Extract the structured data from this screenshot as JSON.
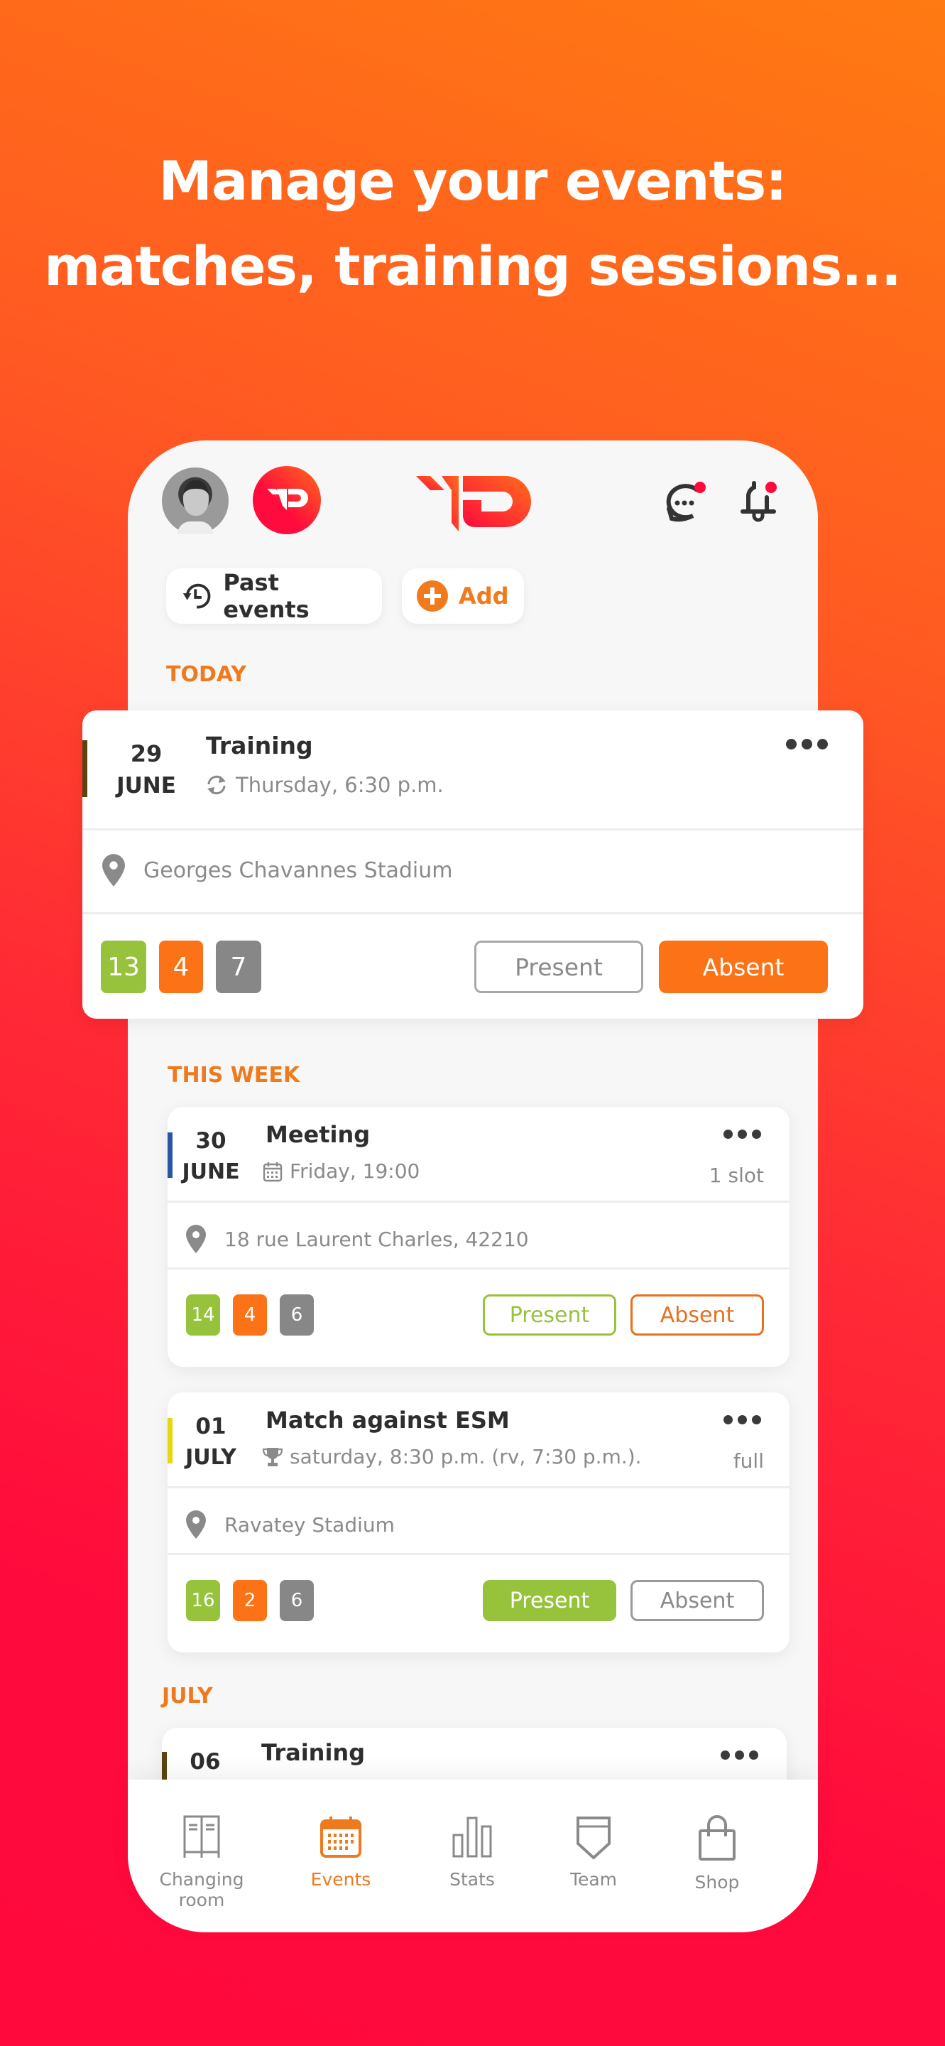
{
  "headline": {
    "line1": "Manage your events:",
    "line2": "matches, training sessions..."
  },
  "header": {
    "avatar": "user-avatar",
    "club_logo": "club-logo",
    "brand_logo": "brand-logo",
    "chat_notification": true,
    "bell_notification": true
  },
  "actions": {
    "past_events": "Past events",
    "add": "Add"
  },
  "colors": {
    "accent_orange": "#ee7a1f",
    "present_green": "#97c23c",
    "absent_orange": "#fb7316",
    "neutral_gray": "#878787",
    "notification_red": "#ff0a3c",
    "brand_red": "#ff0b3d"
  },
  "sections": {
    "today": "TODAY",
    "this_week": "THIS WEEK",
    "july": "JULY"
  },
  "events": [
    {
      "day": "29",
      "month": "JUNE",
      "title": "Training",
      "type_icon": "recurring-icon",
      "when": "Thursday, 6:30 p.m.",
      "note": "",
      "location": "Georges Chavannes Stadium",
      "present_count": "13",
      "absent_count": "4",
      "unknown_count": "7",
      "present_label": "Present",
      "absent_label": "Absent",
      "selected": "absent",
      "accent_color": "#5a4410"
    },
    {
      "day": "30",
      "month": "JUNE",
      "title": "Meeting",
      "type_icon": "calendar-icon",
      "when": "Friday, 19:00",
      "note": "1 slot",
      "location": "18 rue Laurent Charles, 42210",
      "present_count": "14",
      "absent_count": "4",
      "unknown_count": "6",
      "present_label": "Present",
      "absent_label": "Absent",
      "selected": "none",
      "accent_color": "#2a56a6"
    },
    {
      "day": "01",
      "month": "JULY",
      "title": "Match against ESM",
      "type_icon": "trophy-icon",
      "when": "saturday, 8:30 p.m. (rv, 7:30 p.m.).",
      "note": "full",
      "location": "Ravatey Stadium",
      "present_count": "16",
      "absent_count": "2",
      "unknown_count": "6",
      "present_label": "Present",
      "absent_label": "Absent",
      "selected": "present",
      "accent_color": "#e4d90e"
    },
    {
      "day": "06",
      "month": "",
      "title": "Training",
      "accent_color": "#5a4410"
    }
  ],
  "nav": [
    {
      "label": "Changing room",
      "icon": "locker-icon",
      "active": false
    },
    {
      "label": "Events",
      "icon": "calendar-icon",
      "active": true
    },
    {
      "label": "Stats",
      "icon": "bar-chart-icon",
      "active": false
    },
    {
      "label": "Team",
      "icon": "shield-icon",
      "active": false
    },
    {
      "label": "Shop",
      "icon": "shopping-bag-icon",
      "active": false
    }
  ]
}
